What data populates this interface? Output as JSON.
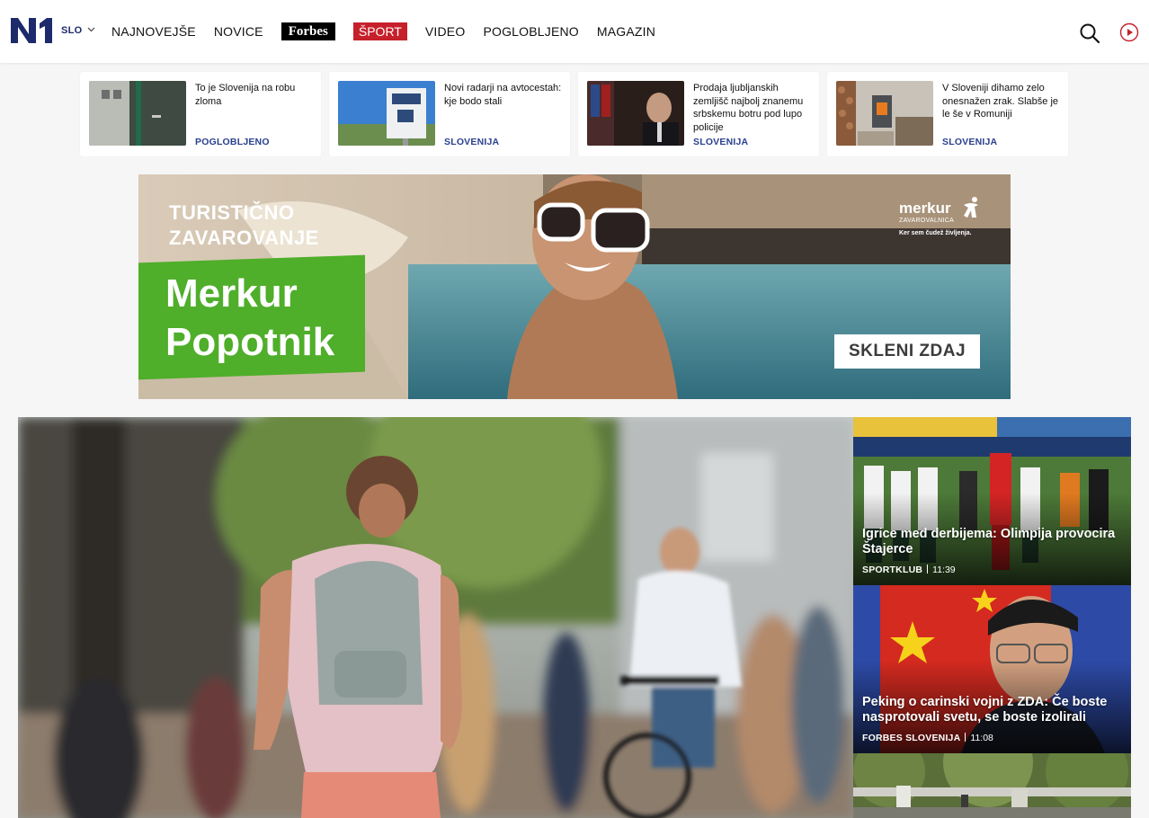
{
  "header": {
    "logo_text": "N1",
    "lang": "SLO",
    "nav": [
      "NAJNOVEJŠE",
      "NOVICE",
      "Forbes",
      "ŠPORT",
      "VIDEO",
      "POGLOBLJENO",
      "MAGAZIN"
    ]
  },
  "strip": [
    {
      "title": "To je Slovenija na robu zloma",
      "category": "POGLOBLJENO"
    },
    {
      "title": "Novi radarji na avtocestah: kje bodo stali",
      "category": "SLOVENIJA"
    },
    {
      "title": "Prodaja ljubljanskih zemljišč najbolj znanemu srbskemu botru pod lupo policije",
      "category": "SLOVENIJA"
    },
    {
      "title": "V Sloveniji dihamo zelo onesnažen zrak. Slabše je le še v Romuniji",
      "category": "SLOVENIJA"
    }
  ],
  "banner": {
    "line1": "TURISTIČNO",
    "line2": "ZAVAROVANJE",
    "product1": "Merkur",
    "product2": "Popotnik",
    "brand": "merkur",
    "brand_sub": "ZAVAROVALNICA",
    "brand_tag": "Ker sem čudež življenja.",
    "cta": "SKLENI ZDAJ",
    "green": "#4fae2a"
  },
  "side": [
    {
      "title": "Igrice med derbijema: Olimpija provocira Štajerce",
      "source": "SPORTKLUB",
      "time": "11:39"
    },
    {
      "title": "Peking o carinski vojni z ZDA: Če boste nasprotovali svetu, se boste izolirali",
      "source": "FORBES SLOVENIJA",
      "time": "11:08"
    }
  ],
  "colors": {
    "brand_blue": "#1d2a6b",
    "sport_red": "#c6202b",
    "category_blue": "#2a4090"
  },
  "icons": [
    "chevron-down-icon",
    "search-icon",
    "play-circle-icon"
  ]
}
